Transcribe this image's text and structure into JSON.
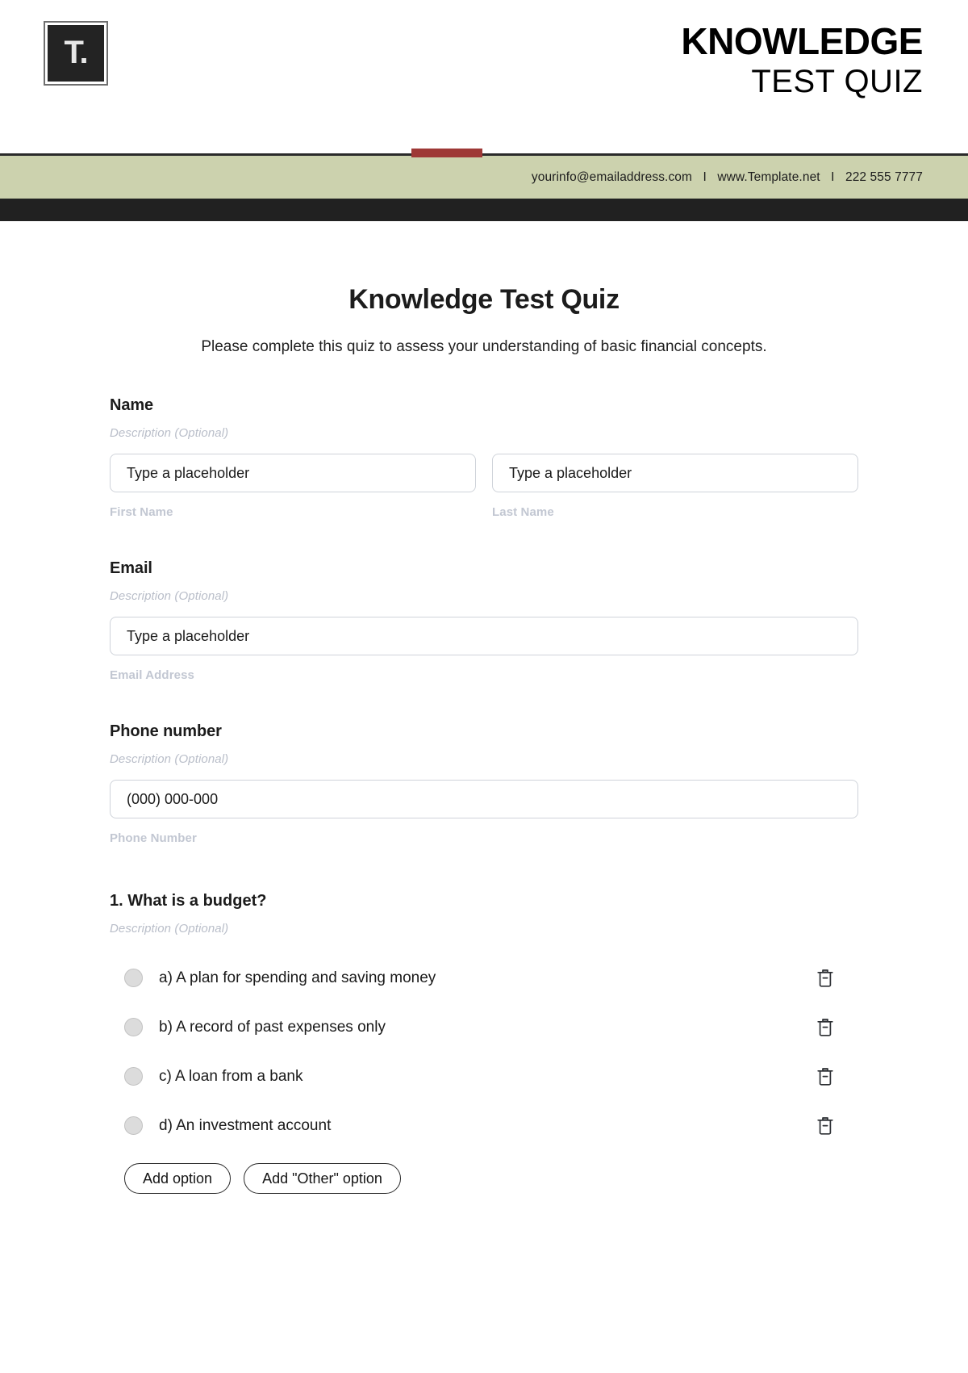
{
  "brand": {
    "logo_text": "T.",
    "title_main": "KNOWLEDGE",
    "title_sub": "TEST QUIZ",
    "accent_color": "#9e3836",
    "bar_color": "#ccd2ae",
    "dark_color": "#212121"
  },
  "contact": {
    "email": "yourinfo@emailaddress.com",
    "separator": "I",
    "website": "www.Template.net",
    "phone": "222 555 7777"
  },
  "form": {
    "title": "Knowledge Test Quiz",
    "subtitle": "Please complete this quiz to assess your understanding of basic financial concepts.",
    "description_placeholder": "Description (Optional)",
    "sections": [
      {
        "label": "Name",
        "description": "Description (Optional)",
        "fields": [
          {
            "placeholder": "Type a placeholder",
            "value": "Type a placeholder",
            "sub_label": "First Name"
          },
          {
            "placeholder": "Type a placeholder",
            "value": "Type a placeholder",
            "sub_label": "Last Name"
          }
        ]
      },
      {
        "label": "Email",
        "description": "Description (Optional)",
        "fields": [
          {
            "placeholder": "Type a placeholder",
            "value": "Type a placeholder",
            "sub_label": "Email Address"
          }
        ]
      },
      {
        "label": "Phone number",
        "description": "Description (Optional)",
        "fields": [
          {
            "placeholder": "(000) 000-000",
            "value": "(000) 000-000",
            "sub_label": "Phone Number"
          }
        ]
      }
    ],
    "question": {
      "label": "1. What is a budget?",
      "description": "Description (Optional)",
      "options": [
        {
          "text": "a) A plan for spending and saving money",
          "delete_icon": "trash-icon"
        },
        {
          "text": "b) A record of past expenses only",
          "delete_icon": "trash-icon"
        },
        {
          "text": "c) A loan from a bank",
          "delete_icon": "trash-icon"
        },
        {
          "text": "d) An investment account",
          "delete_icon": "trash-icon"
        }
      ],
      "add_option_label": "Add option",
      "add_other_option_label": "Add \"Other\" option"
    }
  }
}
